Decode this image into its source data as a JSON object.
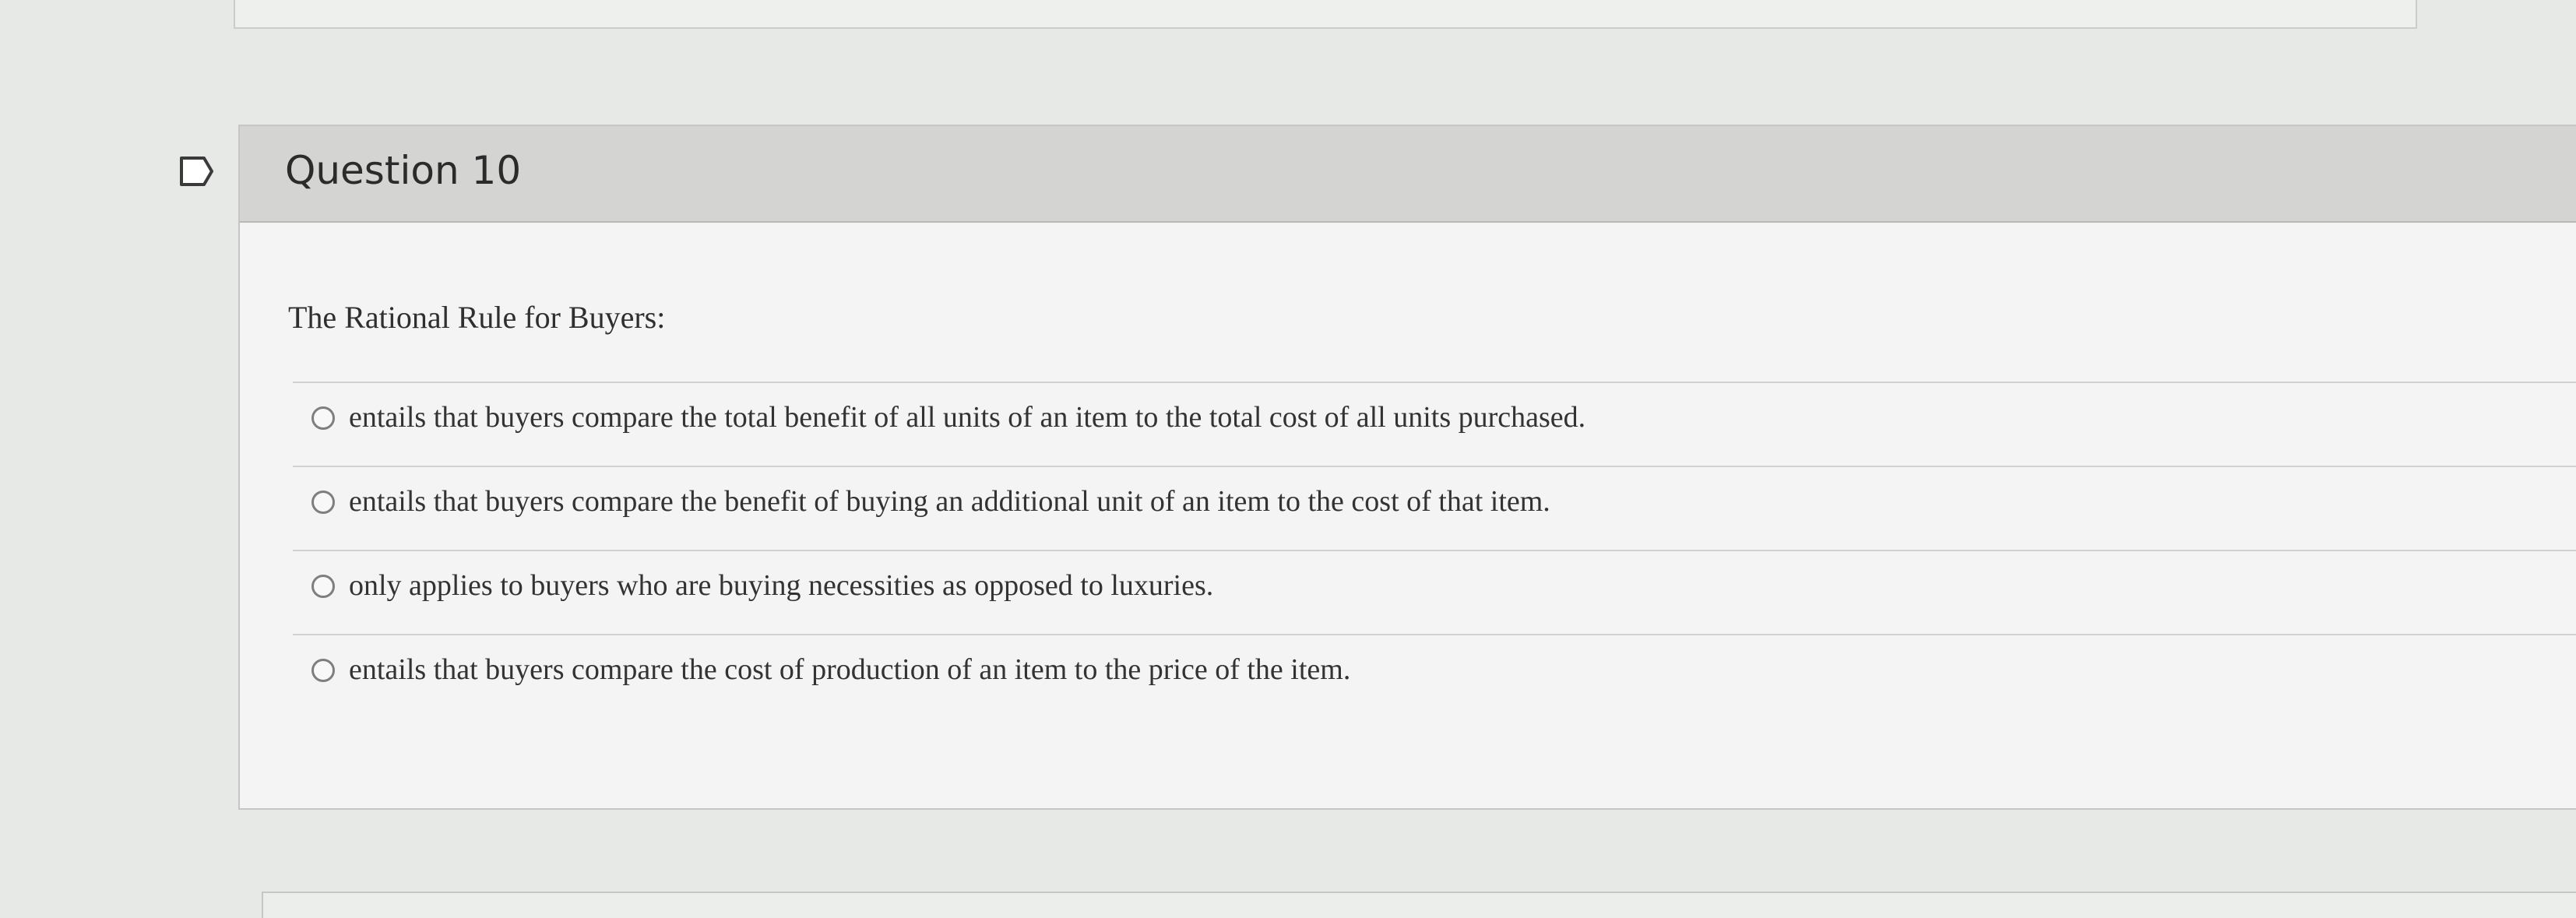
{
  "question": {
    "title": "Question 10",
    "prompt": "The Rational Rule for Buyers:",
    "answers": [
      "entails that buyers compare the total benefit of all units of an item to the total cost of all units purchased.",
      "entails that buyers compare the benefit of buying an additional unit of an item to the cost of that item.",
      "only applies to buyers who are buying necessities as opposed to luxuries.",
      "entails that buyers compare the cost of production of an item to the price of the item."
    ]
  }
}
